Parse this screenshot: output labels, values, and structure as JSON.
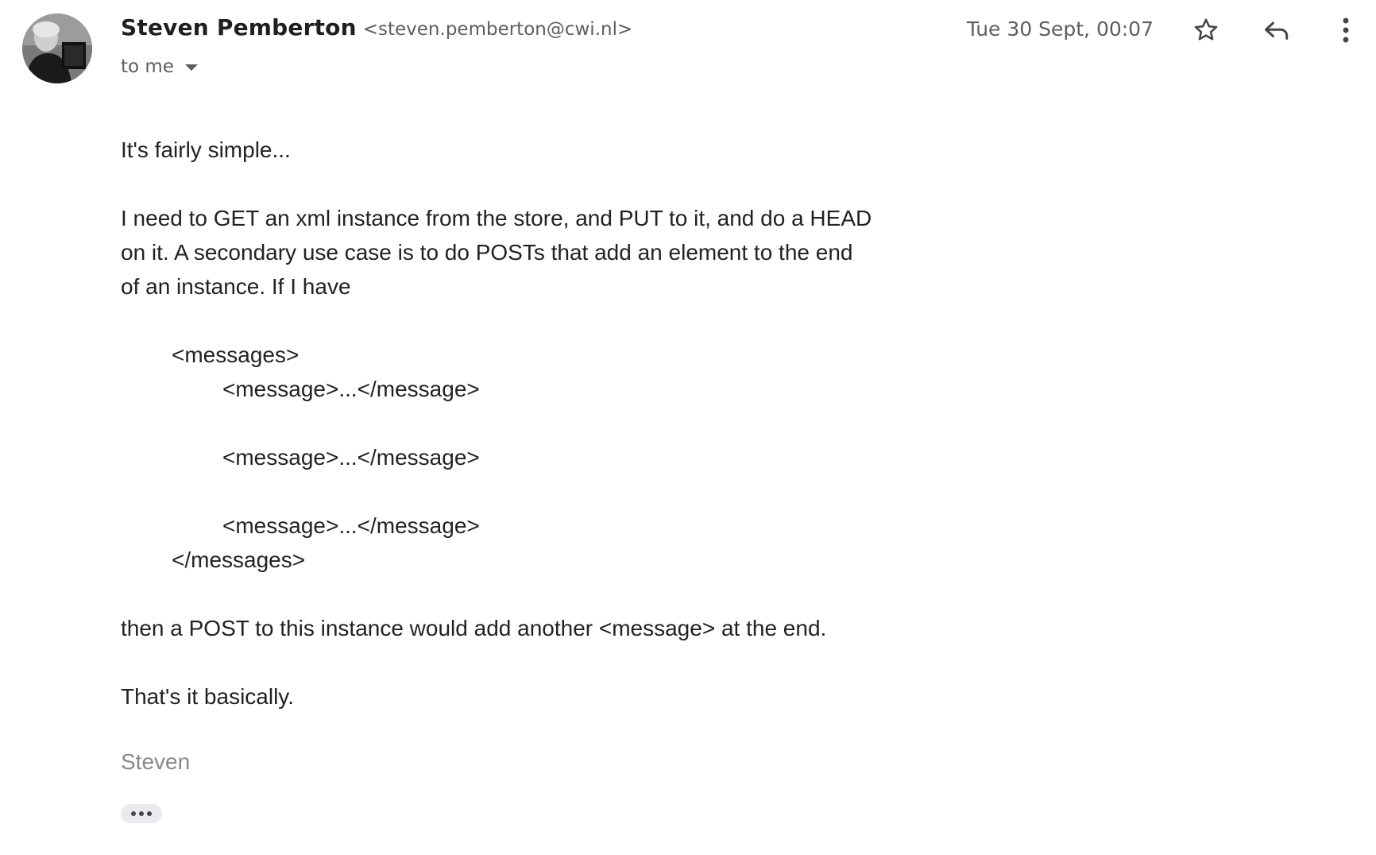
{
  "email": {
    "sender": {
      "name": "Steven Pemberton",
      "email": "<steven.pemberton@cwi.nl>"
    },
    "recipients_label": "to me",
    "timestamp": "Tue 30 Sept, 00:07",
    "body": {
      "p1": "It's fairly simple...",
      "p2_lines": [
        "I need to GET an xml instance from the store, and PUT to it, and do a HEAD",
        "on it. A secondary use case is to do POSTs that add an element to the end",
        "of an instance. If I have"
      ],
      "code": {
        "open": "<messages>",
        "items": [
          "<message>...</message>",
          "<message>...</message>",
          "<message>...</message>"
        ],
        "close": "</messages>"
      },
      "p3": "then a POST to this instance would add another <message> at the end.",
      "p4": "That's it basically."
    },
    "signature": "Steven"
  },
  "icons": {
    "star": "star-outline-icon",
    "reply": "reply-icon",
    "more": "more-vert-icon",
    "recipients_caret": "caret-down-icon",
    "trimmed": "show-trimmed-content-icon"
  },
  "colors": {
    "text_primary": "#1f1f1f",
    "text_secondary": "#5e5e5e",
    "signature": "#888888",
    "chip_bg": "#e8eaed"
  }
}
